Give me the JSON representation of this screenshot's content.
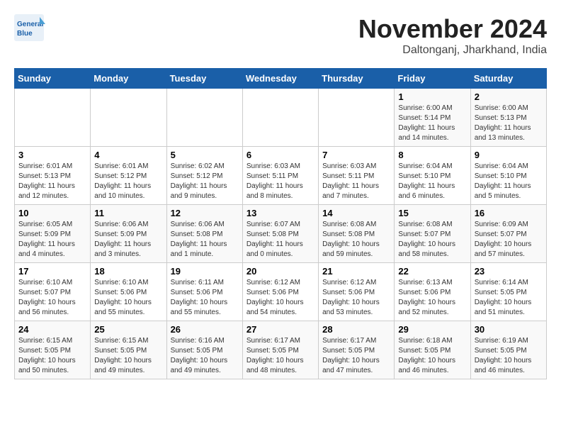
{
  "header": {
    "logo_line1": "General",
    "logo_line2": "Blue",
    "month": "November 2024",
    "location": "Daltonganj, Jharkhand, India"
  },
  "weekdays": [
    "Sunday",
    "Monday",
    "Tuesday",
    "Wednesday",
    "Thursday",
    "Friday",
    "Saturday"
  ],
  "weeks": [
    [
      {
        "day": "",
        "info": ""
      },
      {
        "day": "",
        "info": ""
      },
      {
        "day": "",
        "info": ""
      },
      {
        "day": "",
        "info": ""
      },
      {
        "day": "",
        "info": ""
      },
      {
        "day": "1",
        "info": "Sunrise: 6:00 AM\nSunset: 5:14 PM\nDaylight: 11 hours\nand 14 minutes."
      },
      {
        "day": "2",
        "info": "Sunrise: 6:00 AM\nSunset: 5:13 PM\nDaylight: 11 hours\nand 13 minutes."
      }
    ],
    [
      {
        "day": "3",
        "info": "Sunrise: 6:01 AM\nSunset: 5:13 PM\nDaylight: 11 hours\nand 12 minutes."
      },
      {
        "day": "4",
        "info": "Sunrise: 6:01 AM\nSunset: 5:12 PM\nDaylight: 11 hours\nand 10 minutes."
      },
      {
        "day": "5",
        "info": "Sunrise: 6:02 AM\nSunset: 5:12 PM\nDaylight: 11 hours\nand 9 minutes."
      },
      {
        "day": "6",
        "info": "Sunrise: 6:03 AM\nSunset: 5:11 PM\nDaylight: 11 hours\nand 8 minutes."
      },
      {
        "day": "7",
        "info": "Sunrise: 6:03 AM\nSunset: 5:11 PM\nDaylight: 11 hours\nand 7 minutes."
      },
      {
        "day": "8",
        "info": "Sunrise: 6:04 AM\nSunset: 5:10 PM\nDaylight: 11 hours\nand 6 minutes."
      },
      {
        "day": "9",
        "info": "Sunrise: 6:04 AM\nSunset: 5:10 PM\nDaylight: 11 hours\nand 5 minutes."
      }
    ],
    [
      {
        "day": "10",
        "info": "Sunrise: 6:05 AM\nSunset: 5:09 PM\nDaylight: 11 hours\nand 4 minutes."
      },
      {
        "day": "11",
        "info": "Sunrise: 6:06 AM\nSunset: 5:09 PM\nDaylight: 11 hours\nand 3 minutes."
      },
      {
        "day": "12",
        "info": "Sunrise: 6:06 AM\nSunset: 5:08 PM\nDaylight: 11 hours\nand 1 minute."
      },
      {
        "day": "13",
        "info": "Sunrise: 6:07 AM\nSunset: 5:08 PM\nDaylight: 11 hours\nand 0 minutes."
      },
      {
        "day": "14",
        "info": "Sunrise: 6:08 AM\nSunset: 5:08 PM\nDaylight: 10 hours\nand 59 minutes."
      },
      {
        "day": "15",
        "info": "Sunrise: 6:08 AM\nSunset: 5:07 PM\nDaylight: 10 hours\nand 58 minutes."
      },
      {
        "day": "16",
        "info": "Sunrise: 6:09 AM\nSunset: 5:07 PM\nDaylight: 10 hours\nand 57 minutes."
      }
    ],
    [
      {
        "day": "17",
        "info": "Sunrise: 6:10 AM\nSunset: 5:07 PM\nDaylight: 10 hours\nand 56 minutes."
      },
      {
        "day": "18",
        "info": "Sunrise: 6:10 AM\nSunset: 5:06 PM\nDaylight: 10 hours\nand 55 minutes."
      },
      {
        "day": "19",
        "info": "Sunrise: 6:11 AM\nSunset: 5:06 PM\nDaylight: 10 hours\nand 55 minutes."
      },
      {
        "day": "20",
        "info": "Sunrise: 6:12 AM\nSunset: 5:06 PM\nDaylight: 10 hours\nand 54 minutes."
      },
      {
        "day": "21",
        "info": "Sunrise: 6:12 AM\nSunset: 5:06 PM\nDaylight: 10 hours\nand 53 minutes."
      },
      {
        "day": "22",
        "info": "Sunrise: 6:13 AM\nSunset: 5:06 PM\nDaylight: 10 hours\nand 52 minutes."
      },
      {
        "day": "23",
        "info": "Sunrise: 6:14 AM\nSunset: 5:05 PM\nDaylight: 10 hours\nand 51 minutes."
      }
    ],
    [
      {
        "day": "24",
        "info": "Sunrise: 6:15 AM\nSunset: 5:05 PM\nDaylight: 10 hours\nand 50 minutes."
      },
      {
        "day": "25",
        "info": "Sunrise: 6:15 AM\nSunset: 5:05 PM\nDaylight: 10 hours\nand 49 minutes."
      },
      {
        "day": "26",
        "info": "Sunrise: 6:16 AM\nSunset: 5:05 PM\nDaylight: 10 hours\nand 49 minutes."
      },
      {
        "day": "27",
        "info": "Sunrise: 6:17 AM\nSunset: 5:05 PM\nDaylight: 10 hours\nand 48 minutes."
      },
      {
        "day": "28",
        "info": "Sunrise: 6:17 AM\nSunset: 5:05 PM\nDaylight: 10 hours\nand 47 minutes."
      },
      {
        "day": "29",
        "info": "Sunrise: 6:18 AM\nSunset: 5:05 PM\nDaylight: 10 hours\nand 46 minutes."
      },
      {
        "day": "30",
        "info": "Sunrise: 6:19 AM\nSunset: 5:05 PM\nDaylight: 10 hours\nand 46 minutes."
      }
    ]
  ]
}
